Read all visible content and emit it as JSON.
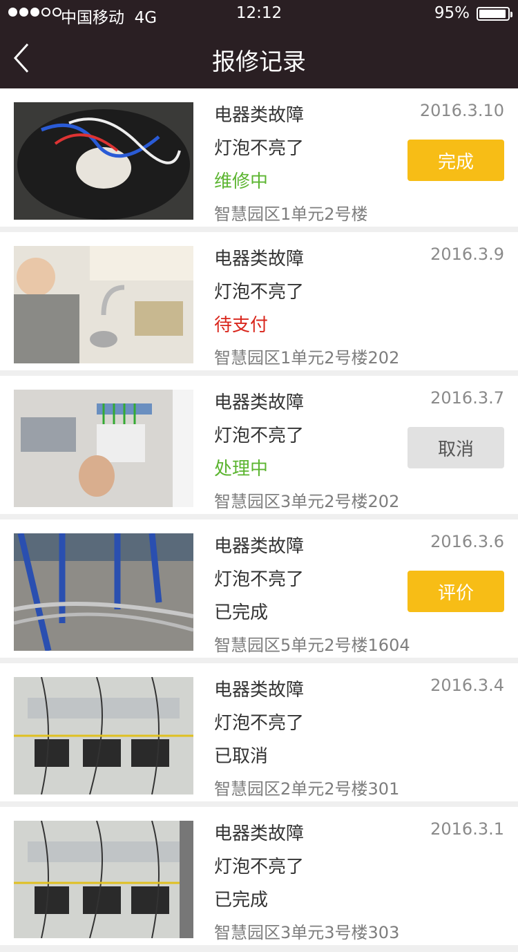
{
  "status_bar": {
    "carrier": "中国移动",
    "network": "4G",
    "time": "12:12",
    "battery": "95%"
  },
  "header": {
    "title": "报修记录"
  },
  "colors": {
    "topbar": "#2a1f23",
    "accent_yellow": "#f7bd16",
    "status_green": "#5cb531",
    "status_red": "#d9251b"
  },
  "records": [
    {
      "category": "电器类故障",
      "description": "灯泡不亮了",
      "status": "维修中",
      "status_color": "#5cb531",
      "address": "智慧园区1单元2号楼",
      "date": "2016.3.10",
      "action": "完成",
      "action_style": "yellow"
    },
    {
      "category": "电器类故障",
      "description": "灯泡不亮了",
      "status": "待支付",
      "status_color": "#d9251b",
      "address": "智慧园区1单元2号楼202",
      "date": "2016.3.9",
      "action": "",
      "action_style": ""
    },
    {
      "category": "电器类故障",
      "description": "灯泡不亮了",
      "status": "处理中",
      "status_color": "#5cb531",
      "address": "智慧园区3单元2号楼202",
      "date": "2016.3.7",
      "action": "取消",
      "action_style": "gray"
    },
    {
      "category": "电器类故障",
      "description": "灯泡不亮了",
      "status": "已完成",
      "status_color": "#333333",
      "address": "智慧园区5单元2号楼1604",
      "date": "2016.3.6",
      "action": "评价",
      "action_style": "yellow"
    },
    {
      "category": "电器类故障",
      "description": "灯泡不亮了",
      "status": "已取消",
      "status_color": "#333333",
      "address": "智慧园区2单元2号楼301",
      "date": "2016.3.4",
      "action": "",
      "action_style": ""
    },
    {
      "category": "电器类故障",
      "description": "灯泡不亮了",
      "status": "已完成",
      "status_color": "#333333",
      "address": "智慧园区3单元3号楼303",
      "date": "2016.3.1",
      "action": "",
      "action_style": ""
    }
  ]
}
